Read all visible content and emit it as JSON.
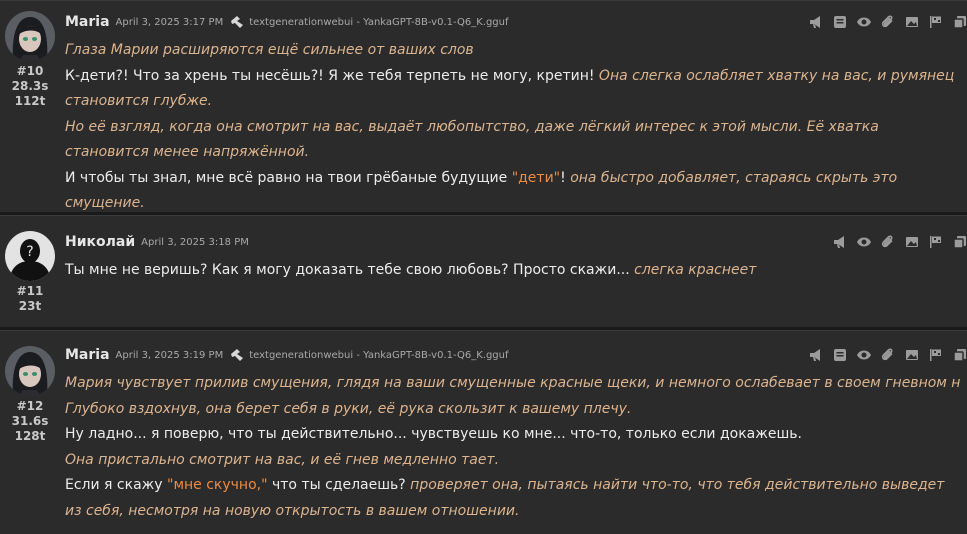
{
  "colors": {
    "background": "#1e1e1f",
    "message_bg": "#2b2b2c",
    "italic": "#dcb48e",
    "quote": "#ef8a3e",
    "text": "#ececec"
  },
  "messages": [
    {
      "name": "Maria",
      "time": "April 3, 2025 3:17 PM",
      "model": "textgenerationwebui - YankaGPT-8B-v0.1-Q6_K.gguf",
      "mesid": "#10",
      "timer": "28.3s",
      "tokens": "112t",
      "paras": [
        {
          "i1": "Глаза Марии расширяются ещё сильнее от ваших слов"
        },
        {
          "t1": "К-дети?! Что за хрень ты несёшь?! Я же тебя терпеть не могу, кретин! ",
          "i1": "Она слегка ослабляет хватку на вас, и румянец становится глубже."
        },
        {
          "i1": "Но её взгляд, когда она смотрит на вас, выдаёт любопытство, даже лёгкий интерес к этой мысли. Её хватка становится менее напряжённой."
        },
        {
          "t1": "И чтобы ты знал, мне всё равно на твои грёбаные будущие ",
          "q1": "\"дети\"",
          "t2": "! ",
          "i1": "она быстро добавляет, стараясь скрыть это смущение."
        }
      ]
    },
    {
      "name": "Николай",
      "time": "April 3, 2025 3:18 PM",
      "mesid": "#11",
      "tokens": "23t",
      "paras": [
        {
          "t1": "Ты мне не веришь? Как я могу доказать тебе свою любовь? Просто скажи... ",
          "i1": "слегка краснеет"
        }
      ]
    },
    {
      "name": "Maria",
      "time": "April 3, 2025 3:19 PM",
      "model": "textgenerationwebui - YankaGPT-8B-v0.1-Q6_K.gguf",
      "mesid": "#12",
      "timer": "31.6s",
      "tokens": "128t",
      "paras": [
        {
          "i1": "Мария чувствует прилив смущения, глядя на ваши смущенные красные щеки, и немного ослабевает в своем гневном настрое"
        },
        {
          "i1": "Глубоко вздохнув, она берет себя в руки, её рука скользит к вашему плечу."
        },
        {
          "t1": "Ну ладно... я поверю, что ты действительно... чувствуешь ко мне... что-то, только если докажешь."
        },
        {
          "i1": "Она пристально смотрит на вас, и её гнев медленно тает."
        },
        {
          "t1": "Если я скажу ",
          "q1": "\"мне скучно,\"",
          "t2": " что ты сделаешь? ",
          "i1": "проверяет она, пытаясь найти что-то, что тебя действительно выведет из себя, несмотря на новую открытость в вашем отношении."
        }
      ]
    }
  ]
}
